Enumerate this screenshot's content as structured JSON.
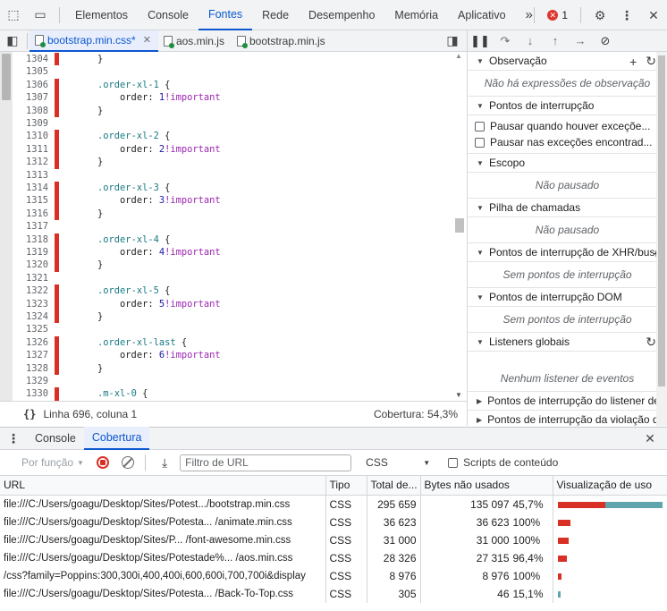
{
  "main_tabs": [
    {
      "label": "Elementos",
      "active": false
    },
    {
      "label": "Console",
      "active": false
    },
    {
      "label": "Fontes",
      "active": true
    },
    {
      "label": "Rede",
      "active": false
    },
    {
      "label": "Desempenho",
      "active": false
    },
    {
      "label": "Memória",
      "active": false
    },
    {
      "label": "Aplicativo",
      "active": false
    }
  ],
  "toolbar": {
    "more_tabs": "»",
    "error_count": "1",
    "error_icon": "error-x-icon",
    "settings_icon": "gear-icon",
    "menu_icon": "kebab-icon",
    "close": "✕"
  },
  "file_tabs": [
    {
      "label": "bootstrap.min.css*",
      "active": true,
      "closable": true
    },
    {
      "label": "aos.min.js",
      "active": false,
      "closable": false
    },
    {
      "label": "bootstrap.min.js",
      "active": false,
      "closable": false
    }
  ],
  "code_lines": [
    {
      "n": "1304",
      "text": "    }",
      "kind": "brace",
      "mark": true
    },
    {
      "n": "1305",
      "text": "",
      "kind": "blank",
      "mark": false
    },
    {
      "n": "1306",
      "sel": ".order-xl-1",
      "kind": "sel",
      "mark": true
    },
    {
      "n": "1307",
      "num": "1",
      "kind": "prop",
      "mark": true
    },
    {
      "n": "1308",
      "text": "    }",
      "kind": "brace",
      "mark": true
    },
    {
      "n": "1309",
      "text": "",
      "kind": "blank",
      "mark": false
    },
    {
      "n": "1310",
      "sel": ".order-xl-2",
      "kind": "sel",
      "mark": true
    },
    {
      "n": "1311",
      "num": "2",
      "kind": "prop",
      "mark": true
    },
    {
      "n": "1312",
      "text": "    }",
      "kind": "brace",
      "mark": true
    },
    {
      "n": "1313",
      "text": "",
      "kind": "blank",
      "mark": false
    },
    {
      "n": "1314",
      "sel": ".order-xl-3",
      "kind": "sel",
      "mark": true
    },
    {
      "n": "1315",
      "num": "3",
      "kind": "prop",
      "mark": true
    },
    {
      "n": "1316",
      "text": "    }",
      "kind": "brace",
      "mark": true
    },
    {
      "n": "1317",
      "text": "",
      "kind": "blank",
      "mark": false
    },
    {
      "n": "1318",
      "sel": ".order-xl-4",
      "kind": "sel",
      "mark": true
    },
    {
      "n": "1319",
      "num": "4",
      "kind": "prop",
      "mark": true
    },
    {
      "n": "1320",
      "text": "    }",
      "kind": "brace",
      "mark": true
    },
    {
      "n": "1321",
      "text": "",
      "kind": "blank",
      "mark": false
    },
    {
      "n": "1322",
      "sel": ".order-xl-5",
      "kind": "sel",
      "mark": true
    },
    {
      "n": "1323",
      "num": "5",
      "kind": "prop",
      "mark": true
    },
    {
      "n": "1324",
      "text": "    }",
      "kind": "brace",
      "mark": true
    },
    {
      "n": "1325",
      "text": "",
      "kind": "blank",
      "mark": false
    },
    {
      "n": "1326",
      "sel": ".order-xl-last",
      "kind": "sel",
      "mark": true
    },
    {
      "n": "1327",
      "num": "6",
      "kind": "prop",
      "mark": true
    },
    {
      "n": "1328",
      "text": "    }",
      "kind": "brace",
      "mark": true
    },
    {
      "n": "1329",
      "text": "",
      "kind": "blank",
      "mark": false
    },
    {
      "n": "1330",
      "sel": ".m-xl-0",
      "kind": "sel",
      "mark": true
    }
  ],
  "code_tokens": {
    "prop": "order",
    "important": "!important",
    "open_brace": " {"
  },
  "status": {
    "position": "Linha 696, coluna 1",
    "coverage": "Cobertura: 54,3%"
  },
  "sidebar": {
    "watch": {
      "title": "Observação",
      "empty": "Não há expressões de observação"
    },
    "breakpoints": {
      "title": "Pontos de interrupção",
      "opt1": "Pausar quando houver exceçõe...",
      "opt2": "Pausar nas exceções encontrad..."
    },
    "scope": {
      "title": "Escopo",
      "empty": "Não pausado"
    },
    "callstack": {
      "title": "Pilha de chamadas",
      "empty": "Não pausado"
    },
    "xhr": {
      "title": "Pontos de interrupção de XHR/busca",
      "empty": "Sem pontos de interrupção"
    },
    "dom": {
      "title": "Pontos de interrupção DOM",
      "empty": "Sem pontos de interrupção"
    },
    "listeners": {
      "title": "Listeners globais",
      "empty": "Nenhum listener de eventos"
    },
    "event_bp": {
      "title": "Pontos de interrupção do listener de eventos"
    },
    "csp_bp": {
      "title": "Pontos de interrupção da violação de CSP"
    }
  },
  "drawer": {
    "tabs": [
      {
        "label": "Console",
        "active": false
      },
      {
        "label": "Cobertura",
        "active": true
      }
    ],
    "per_function": "Por função",
    "url_filter_placeholder": "Filtro de URL",
    "type_filter": "CSS",
    "content_scripts": "Scripts de conteúdo",
    "columns": [
      "URL",
      "Tipo",
      "Total de...",
      "Bytes não usados",
      "Visualização de uso"
    ],
    "rows": [
      {
        "url": "file:///C:/Users/goagu/Desktop/Sites/Potest.../bootstrap.min.css",
        "type": "CSS",
        "total": "295 659",
        "unused": "135 097",
        "pct": "45,7%",
        "unused_frac": 0.457,
        "size_frac": 1.0
      },
      {
        "url": "file:///C:/Users/goagu/Desktop/Sites/Potesta... /animate.min.css",
        "type": "CSS",
        "total": "36 623",
        "unused": "36 623",
        "pct": "100%",
        "unused_frac": 1.0,
        "size_frac": 0.124
      },
      {
        "url": "file:///C:/Users/goagu/Desktop/Sites/P... /font-awesome.min.css",
        "type": "CSS",
        "total": "31 000",
        "unused": "31 000",
        "pct": "100%",
        "unused_frac": 1.0,
        "size_frac": 0.105
      },
      {
        "url": "file:///C:/Users/goagu/Desktop/Sites/Potestade%... /aos.min.css",
        "type": "CSS",
        "total": "28 326",
        "unused": "27 315",
        "pct": "96,4%",
        "unused_frac": 0.964,
        "size_frac": 0.096
      },
      {
        "url": "/css?family=Poppins:300,300i,400,400i,600,600i,700,700i&display",
        "type": "CSS",
        "total": "8 976",
        "unused": "8 976",
        "pct": "100%",
        "unused_frac": 1.0,
        "size_frac": 0.03
      },
      {
        "url": "file:///C:/Users/goagu/Desktop/Sites/Potesta... /Back-To-Top.css",
        "type": "CSS",
        "total": "305",
        "unused": "46",
        "pct": "15,1%",
        "unused_frac": 0.151,
        "size_frac": 0.012
      }
    ]
  },
  "colors": {
    "accent": "#0b57d0",
    "unused": "#d93025",
    "used": "#5fa5ad",
    "marker": "#d93025"
  }
}
